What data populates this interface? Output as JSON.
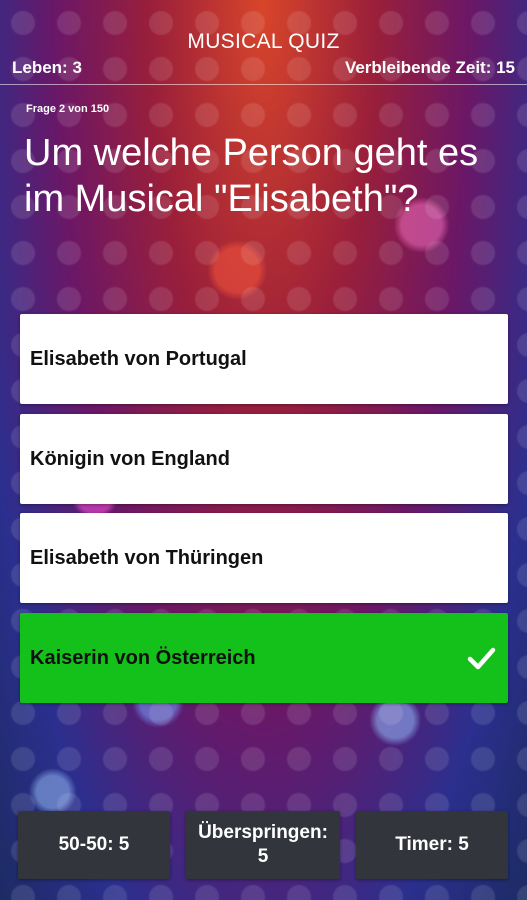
{
  "header": {
    "app_title": "MUSICAL QUIZ",
    "lives": "Leben: 3",
    "time_remaining": "Verbleibende Zeit: 15"
  },
  "quiz": {
    "progress": "Frage 2 von 150",
    "question": "Um welche Person geht es im Musical \"Elisabeth\"?",
    "answers": [
      {
        "label": "Elisabeth von Portugal",
        "state": "default"
      },
      {
        "label": "Königin von England",
        "state": "default"
      },
      {
        "label": "Elisabeth von Thüringen",
        "state": "default"
      },
      {
        "label": "Kaiserin von Österreich",
        "state": "correct",
        "icon": "checkmark-icon"
      }
    ]
  },
  "lifelines": {
    "fifty_fifty": "50-50: 5",
    "skip_line1": "Überspringen:",
    "skip_line2": "5",
    "timer": "Timer: 5"
  },
  "colors": {
    "correct": "#14c01a",
    "lifeline_bg": "#32353b"
  }
}
